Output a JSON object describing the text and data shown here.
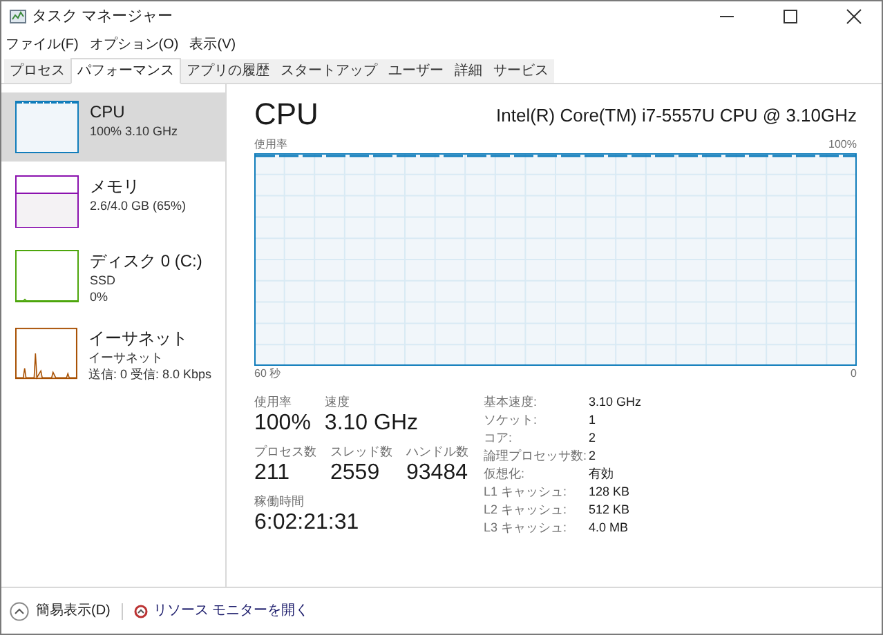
{
  "window": {
    "title": "タスク マネージャー"
  },
  "menu": [
    "ファイル(F)",
    "オプション(O)",
    "表示(V)"
  ],
  "tabs": [
    {
      "label": "プロセス",
      "selected": false
    },
    {
      "label": "パフォーマンス",
      "selected": true
    },
    {
      "label": "アプリの履歴",
      "selected": false
    },
    {
      "label": "スタートアップ",
      "selected": false
    },
    {
      "label": "ユーザー",
      "selected": false
    },
    {
      "label": "詳細",
      "selected": false
    },
    {
      "label": "サービス",
      "selected": false
    }
  ],
  "sidebar": {
    "items": [
      {
        "kind": "cpu",
        "title": "CPU",
        "lines": [
          "100% 3.10 GHz"
        ],
        "selected": true
      },
      {
        "kind": "memory",
        "title": "メモリ",
        "lines": [
          "2.6/4.0 GB (65%)"
        ],
        "selected": false
      },
      {
        "kind": "disk",
        "title": "ディスク 0 (C:)",
        "lines": [
          "SSD",
          "0%"
        ],
        "selected": false
      },
      {
        "kind": "network",
        "title": "イーサネット",
        "lines": [
          "イーサネット",
          "送信: 0 受信: 8.0 Kbps"
        ],
        "selected": false
      }
    ]
  },
  "main": {
    "title": "CPU",
    "model": "Intel(R) Core(TM) i7-5557U CPU @ 3.10GHz",
    "graph": {
      "ylabel": "使用率",
      "ymax": "100%",
      "xmin": "60 秒",
      "xmax": "0"
    },
    "stats": [
      [
        {
          "label": "使用率",
          "value": "100%"
        },
        {
          "label": "速度",
          "value": "3.10 GHz"
        }
      ],
      [
        {
          "label": "プロセス数",
          "value": "211"
        },
        {
          "label": "スレッド数",
          "value": "2559"
        },
        {
          "label": "ハンドル数",
          "value": "93484"
        }
      ],
      [
        {
          "label": "稼働時間",
          "value": "6:02:21:31"
        }
      ]
    ],
    "details": [
      {
        "label": "基本速度:",
        "value": "3.10 GHz"
      },
      {
        "label": "ソケット:",
        "value": "1"
      },
      {
        "label": "コア:",
        "value": "2"
      },
      {
        "label": "論理プロセッサ数:",
        "value": "2"
      },
      {
        "label": "仮想化:",
        "value": "有効"
      },
      {
        "label": "L1 キャッシュ:",
        "value": "128 KB"
      },
      {
        "label": "L2 キャッシュ:",
        "value": "512 KB"
      },
      {
        "label": "L3 キャッシュ:",
        "value": "4.0 MB"
      }
    ]
  },
  "footer": {
    "fewer_details": "簡易表示(D)",
    "resource_monitor": "リソース モニターを開く"
  }
}
